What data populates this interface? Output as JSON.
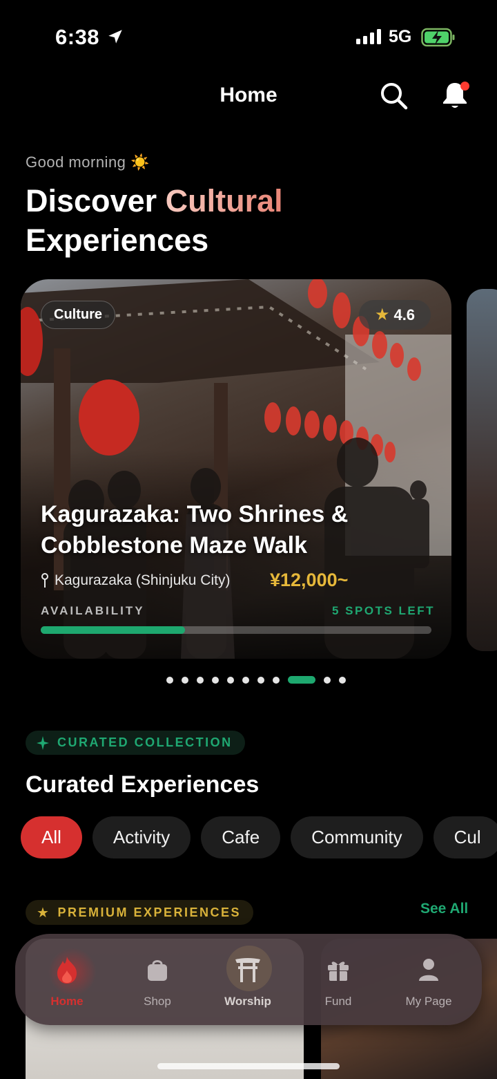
{
  "status_bar": {
    "time": "6:38",
    "network": "5G"
  },
  "header": {
    "title": "Home"
  },
  "greeting": "Good morning ☀️",
  "hero": {
    "title_line1_plain": "Discover ",
    "title_line1_accent": "Cultural",
    "title_line2": "Experiences"
  },
  "featured_card": {
    "category": "Culture",
    "rating": "4.6",
    "title": "Kagurazaka: Two Shrines & Cobblestone Maze Walk",
    "location": "Kagurazaka (Shinjuku City)",
    "price": "¥12,000~",
    "availability_label": "AVAILABILITY",
    "spots_left": "5 SPOTS LEFT",
    "availability_fraction": 0.37
  },
  "carousel": {
    "total_pages": 11,
    "active_index": 8
  },
  "curated": {
    "badge": "CURATED COLLECTION",
    "title": "Curated Experiences",
    "filters": [
      "All",
      "Activity",
      "Cafe",
      "Community",
      "Cul"
    ],
    "active_filter": "All"
  },
  "premium": {
    "badge": "PREMIUM EXPERIENCES",
    "see_all": "See All"
  },
  "tabbar": {
    "tabs": [
      {
        "label": "Home",
        "icon": "flame-icon"
      },
      {
        "label": "Shop",
        "icon": "shopping-bag-icon"
      },
      {
        "label": "Worship",
        "icon": "torii-gate-icon"
      },
      {
        "label": "Fund",
        "icon": "gift-icon"
      },
      {
        "label": "My Page",
        "icon": "person-icon"
      }
    ],
    "active": "Home"
  },
  "colors": {
    "accent_green": "#1ea86f",
    "accent_red": "#d6302f",
    "gold": "#e6b83a"
  }
}
